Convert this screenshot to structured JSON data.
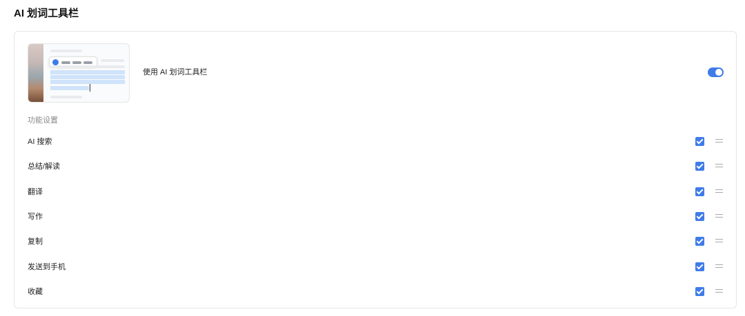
{
  "page": {
    "title": "AI 划词工具栏"
  },
  "toggle": {
    "label": "使用 AI 划词工具栏",
    "enabled": true
  },
  "section": {
    "label": "功能设置"
  },
  "features": [
    {
      "label": "AI 搜索",
      "checked": true
    },
    {
      "label": "总结/解读",
      "checked": true
    },
    {
      "label": "翻译",
      "checked": true
    },
    {
      "label": "写作",
      "checked": true
    },
    {
      "label": "复制",
      "checked": true
    },
    {
      "label": "发送到手机",
      "checked": true
    },
    {
      "label": "收藏",
      "checked": true
    }
  ],
  "colors": {
    "accent": "#3f7ce8",
    "border": "#e6e6e6",
    "muted": "#8a8a8a"
  },
  "icons": {
    "drag": "drag-handle-icon",
    "check": "checkbox-checked-icon"
  }
}
